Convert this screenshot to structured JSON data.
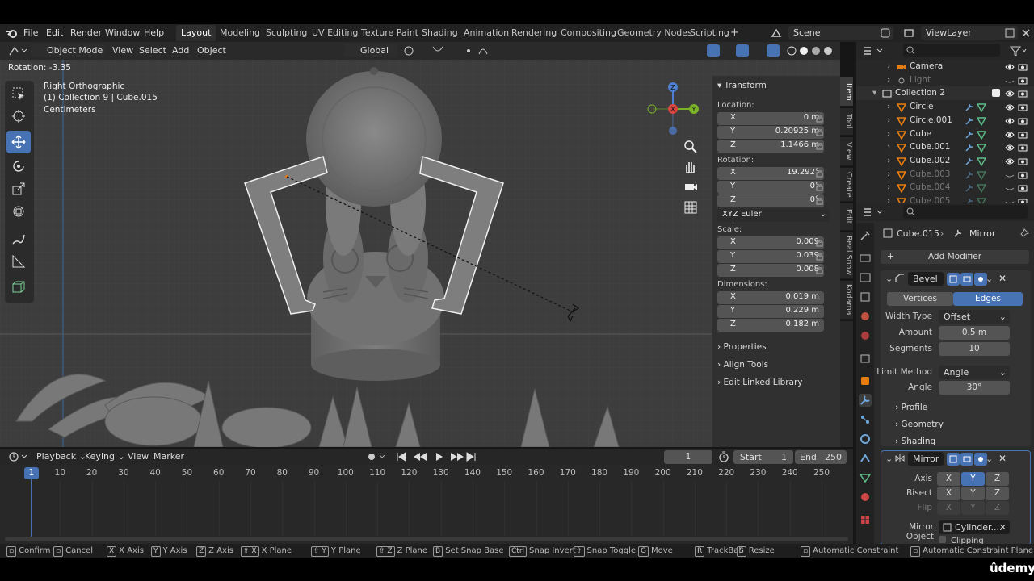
{
  "menus": [
    "File",
    "Edit",
    "Render",
    "Window",
    "Help"
  ],
  "workspaces": [
    "Layout",
    "Modeling",
    "Sculpting",
    "UV Editing",
    "Texture Paint",
    "Shading",
    "Animation",
    "Rendering",
    "Compositing",
    "Geometry Nodes",
    "Scripting",
    "+"
  ],
  "scene": "Scene",
  "view_layer": "ViewLayer",
  "vp_header": {
    "mode": "Object Mode",
    "menus": [
      "View",
      "Select",
      "Add",
      "Object"
    ],
    "orientation": "Global",
    "status_text": "Rotation: -3.35"
  },
  "viewport_overlay": {
    "view_name": "Right Orthographic",
    "collection_line": "(1) Collection 9 | Cube.015",
    "units": "Centimeters"
  },
  "gizmo": {
    "x": "X",
    "y": "Y",
    "z": "Z"
  },
  "npanel": {
    "title": "Transform",
    "location_label": "Location:",
    "location": [
      {
        "axis": "X",
        "value": "0 m"
      },
      {
        "axis": "Y",
        "value": "0.20925 m"
      },
      {
        "axis": "Z",
        "value": "1.1466 m"
      }
    ],
    "rotation_label": "Rotation:",
    "rotation": [
      {
        "axis": "X",
        "value": "19.292°"
      },
      {
        "axis": "Y",
        "value": "0°"
      },
      {
        "axis": "Z",
        "value": "0°"
      }
    ],
    "rotation_mode": "XYZ Euler",
    "scale_label": "Scale:",
    "scale": [
      {
        "axis": "X",
        "value": "0.009"
      },
      {
        "axis": "Y",
        "value": "0.039"
      },
      {
        "axis": "Z",
        "value": "0.008"
      }
    ],
    "dimensions_label": "Dimensions:",
    "dimensions": [
      {
        "axis": "X",
        "value": "0.019 m"
      },
      {
        "axis": "Y",
        "value": "0.229 m"
      },
      {
        "axis": "Z",
        "value": "0.182 m"
      }
    ],
    "sections": [
      "Properties",
      "Align Tools",
      "Edit Linked Library"
    ],
    "tabs": [
      "Item",
      "Tool",
      "View",
      "Create",
      "Edit",
      "Real Snow",
      "Kodama"
    ]
  },
  "outliner": {
    "rows": [
      {
        "name": "Camera",
        "dim": false
      },
      {
        "name": "Light",
        "dim": true
      },
      {
        "name": "Collection 2",
        "dim": false
      },
      {
        "name": "Circle",
        "dim": false
      },
      {
        "name": "Circle.001",
        "dim": false
      },
      {
        "name": "Cube",
        "dim": false
      },
      {
        "name": "Cube.001",
        "dim": false
      },
      {
        "name": "Cube.002",
        "dim": false
      },
      {
        "name": "Cube.003",
        "dim": true
      },
      {
        "name": "Cube.004",
        "dim": true
      },
      {
        "name": "Cube.005",
        "dim": true
      }
    ]
  },
  "properties": {
    "object": "Cube.015",
    "modifier_context": "Mirror",
    "add_modifier": "Add Modifier",
    "bevel": {
      "name": "Bevel",
      "affect": [
        "Vertices",
        "Edges"
      ],
      "width_type_label": "Width Type",
      "width_type": "Offset",
      "amount_label": "Amount",
      "amount": "0.5 m",
      "segments_label": "Segments",
      "segments": "10",
      "limit_method_label": "Limit Method",
      "limit_method": "Angle",
      "angle_label": "Angle",
      "angle": "30°",
      "subpanels": [
        "Profile",
        "Geometry",
        "Shading"
      ]
    },
    "mirror": {
      "name": "Mirror",
      "axis_label": "Axis",
      "bisect_label": "Bisect",
      "flip_label": "Flip",
      "axes": [
        "X",
        "Y",
        "Z"
      ],
      "mirror_object_label": "Mirror Object",
      "mirror_object": "Cylinder....",
      "clipping_label": "Clipping"
    }
  },
  "timeline": {
    "menus": [
      "Playback",
      "Keying",
      "View",
      "Marker"
    ],
    "current_frame": "1",
    "start_label": "Start",
    "start": "1",
    "end_label": "End",
    "end": "250",
    "ticks": [
      "1",
      "10",
      "20",
      "30",
      "40",
      "50",
      "60",
      "70",
      "80",
      "90",
      "100",
      "110",
      "120",
      "130",
      "140",
      "150",
      "160",
      "170",
      "180",
      "190",
      "200",
      "210",
      "220",
      "230",
      "240",
      "250"
    ]
  },
  "statusbar": [
    {
      "key": "",
      "text": "Confirm"
    },
    {
      "key": "",
      "text": "Cancel"
    },
    {
      "key": "X",
      "text": "X Axis"
    },
    {
      "key": "Y",
      "text": "Y Axis"
    },
    {
      "key": "Z",
      "text": "Z Axis"
    },
    {
      "key": "⇧ X",
      "text": "X Plane"
    },
    {
      "key": "⇧ Y",
      "text": "Y Plane"
    },
    {
      "key": "⇧ Z",
      "text": "Z Plane"
    },
    {
      "key": "B",
      "text": "Set Snap Base"
    },
    {
      "key": "Ctrl",
      "text": "Snap Invert"
    },
    {
      "key": "⇧",
      "text": "Snap Toggle"
    },
    {
      "key": "G",
      "text": "Move"
    },
    {
      "key": "R",
      "text": "TrackBall"
    },
    {
      "key": "S",
      "text": "Resize"
    },
    {
      "key": "",
      "text": "Automatic Constraint"
    },
    {
      "key": "",
      "text": "Automatic Constraint Plane"
    }
  ],
  "watermark": "ûdemy",
  "colors": {
    "accent": "#4772b3",
    "orange": "#e87d0d",
    "object_green": "#5ec08a",
    "mod_blue": "#6fa8dc"
  }
}
